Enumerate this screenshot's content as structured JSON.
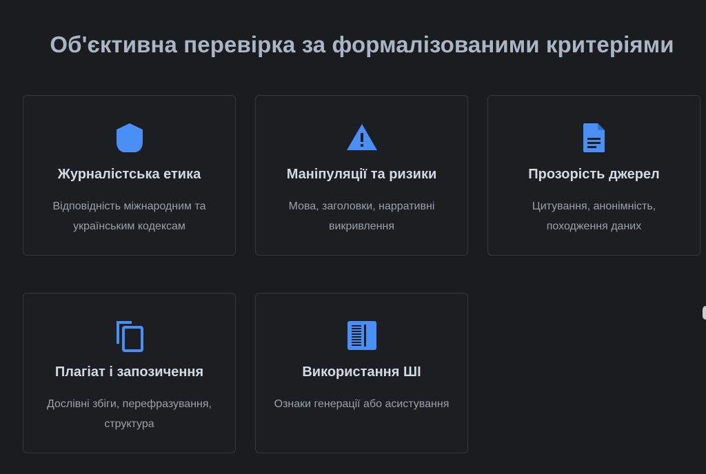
{
  "section": {
    "heading": "Об'єктивна перевірка за формалізованими критеріями"
  },
  "cards": [
    {
      "icon": "shield-icon",
      "title": "Журналістська етика",
      "description": "Відповідність міжнародним та українським кодексам"
    },
    {
      "icon": "warning-icon",
      "title": "Маніпуляції та ризики",
      "description": "Мова, заголовки, нарративні викривлення"
    },
    {
      "icon": "document-icon",
      "title": "Прозорість джерел",
      "description": "Цитування, анонімність, походження даних"
    },
    {
      "icon": "copy-icon",
      "title": "Плагіат і запозичення",
      "description": "Дослівні збіги, перефразування, структура"
    },
    {
      "icon": "ai-text-icon",
      "title": "Використання ШІ",
      "description": "Ознаки генерації або асистування"
    }
  ],
  "colors": {
    "background": "#1b1c1f",
    "card_border": "#36383d",
    "accent_icon": "#4a8ff5",
    "heading": "#aab6c4",
    "card_title": "#d3dae2",
    "card_text": "#9aa1a9"
  }
}
